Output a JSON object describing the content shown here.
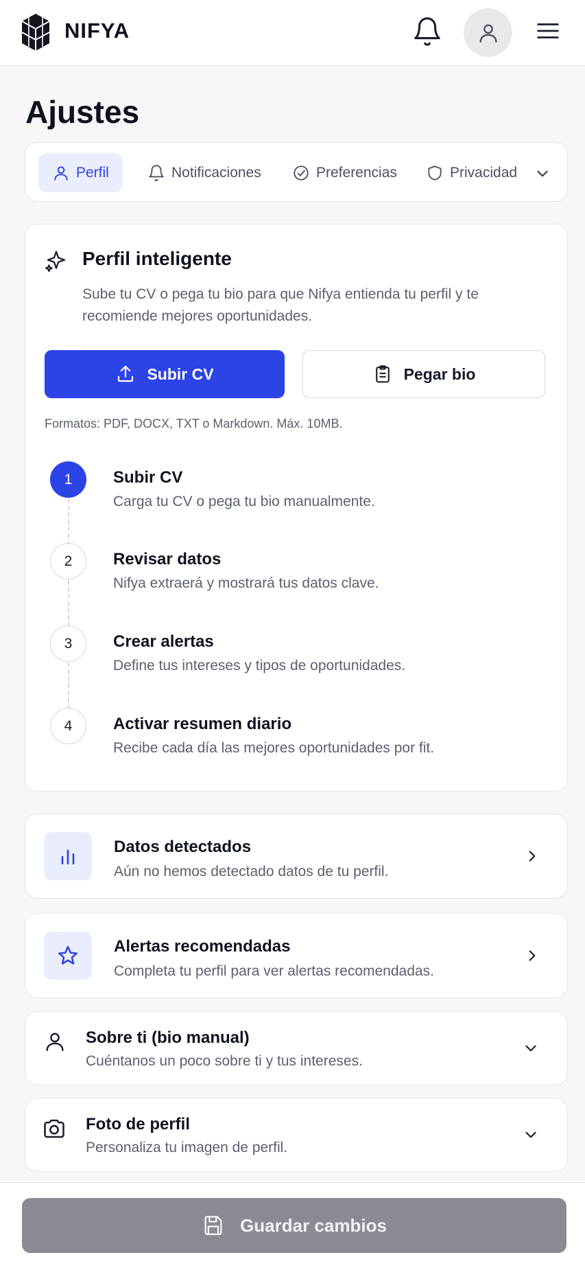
{
  "header": {
    "brand": "NIFYA",
    "icons": {
      "logo": "nifya-logo-icon",
      "bell": "bell-icon",
      "avatar": "user-icon",
      "menu": "menu-icon"
    }
  },
  "page": {
    "title": "Ajustes"
  },
  "tabs": [
    {
      "label": "Perfil",
      "icon": "user-icon",
      "active": true
    },
    {
      "label": "Notificaciones",
      "icon": "bell-icon",
      "active": false
    },
    {
      "label": "Preferencias",
      "icon": "check-circle-icon",
      "active": false
    },
    {
      "label": "Privacidad",
      "icon": "shield-icon",
      "active": false
    }
  ],
  "smart_profile": {
    "title": "Perfil inteligente",
    "description": "Sube tu CV o pega tu bio para que Nifya entienda tu perfil y te recomiende mejores oportunidades.",
    "upload_label": "Subir CV",
    "paste_label": "Pegar bio",
    "formats": "Formatos: PDF, DOCX, TXT o Markdown. Máx. 10MB.",
    "steps": [
      {
        "num": "1",
        "title": "Subir CV",
        "desc": "Carga tu CV o pega tu bio manualmente.",
        "active": true
      },
      {
        "num": "2",
        "title": "Revisar datos",
        "desc": "Nifya extraerá y mostrará tus datos clave.",
        "active": false
      },
      {
        "num": "3",
        "title": "Crear alertas",
        "desc": "Define tus intereses y tipos de oportunidades.",
        "active": false
      },
      {
        "num": "4",
        "title": "Activar resumen diario",
        "desc": "Recibe cada día las mejores oportunidades por fit.",
        "active": false
      }
    ]
  },
  "sections": {
    "detected": {
      "title": "Datos detectados",
      "desc": "Aún no hemos detectado datos de tu perfil.",
      "icon": "bar-chart-icon"
    },
    "alerts": {
      "title": "Alertas recomendadas",
      "desc": "Completa tu perfil para ver alertas recomendadas.",
      "icon": "star-icon"
    },
    "bio": {
      "title": "Sobre ti (bio manual)",
      "desc": "Cuéntanos un poco sobre ti y tus intereses.",
      "icon": "user-icon"
    },
    "photo": {
      "title": "Foto de perfil",
      "desc": "Personaliza tu imagen de perfil.",
      "icon": "camera-icon"
    }
  },
  "footer": {
    "save_label": "Guardar cambios",
    "icon": "save-icon"
  },
  "colors": {
    "accent": "#2c43e6",
    "accent_soft": "#eaeefc",
    "disabled": "#8a8b92"
  }
}
